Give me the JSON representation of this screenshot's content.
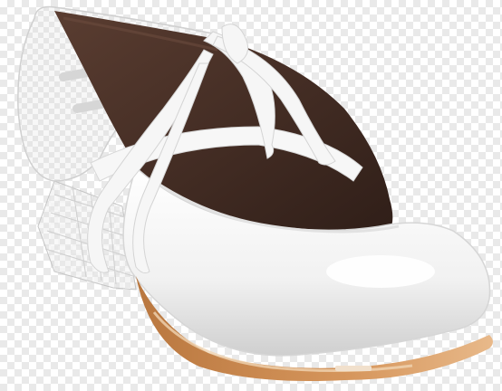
{
  "image": {
    "subject": "flamenco-shoe",
    "background": "transparent-checkerboard",
    "colors": {
      "upper": "#f4f4f4",
      "upper_shadow": "#c9c9c9",
      "lining": "#4a3128",
      "lining_dark": "#2e1d17",
      "sole": "#c98a52",
      "sole_light": "#e9c59a",
      "ribbon": "#f6f6f6",
      "heel_outline": "#bdbdbd"
    }
  }
}
